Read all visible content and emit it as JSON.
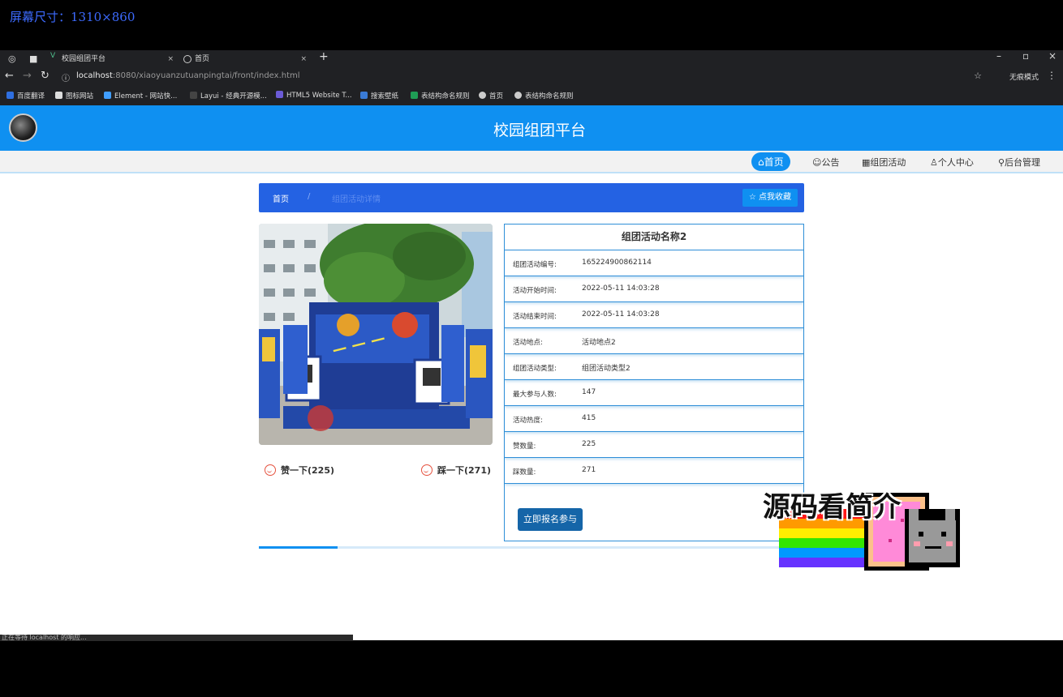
{
  "screen_caption": "屏幕尺寸：1310×860",
  "browser": {
    "tabs": [
      {
        "label": "校园组团平台",
        "close": "×"
      },
      {
        "label": "首页",
        "close": "×"
      }
    ],
    "new_tab": "+",
    "url_host": "localhost",
    "url_rest": ":8080/xiaoyuanzutuanpingtai/front/index.html",
    "incognito_label": "无痕模式",
    "bookmarks": [
      "百度翻译",
      "图标网站",
      "Element - 网站快...",
      "Layui - 经典开源模...",
      "HTML5 Website T...",
      "搜索壁纸",
      "表结构命名规则",
      "首页",
      "表结构命名规则"
    ],
    "status_tip": "正在等待 localhost 的响应..."
  },
  "header": {
    "title": "校园组团平台"
  },
  "nav": {
    "home": "⌂首页",
    "notice": "☺公告",
    "activity": "▦组团活动",
    "profile": "♙个人中心",
    "admin": "⚲后台管理"
  },
  "breadcrumb": {
    "home": "首页",
    "separator": "/",
    "current": "组团活动详情",
    "favorite": "☆ 点我收藏"
  },
  "detail": {
    "title": "组团活动名称2",
    "rows": [
      {
        "label": "组团活动编号:",
        "value": "165224900862114"
      },
      {
        "label": "活动开始时间:",
        "value": "2022-05-11 14:03:28"
      },
      {
        "label": "活动结束时间:",
        "value": "2022-05-11 14:03:28"
      },
      {
        "label": "活动地点:",
        "value": "活动地点2"
      },
      {
        "label": "组团活动类型:",
        "value": "组团活动类型2"
      },
      {
        "label": "最大参与人数:",
        "value": "147"
      },
      {
        "label": "活动热度:",
        "value": "415"
      },
      {
        "label": "赞数量:",
        "value": "225"
      },
      {
        "label": "踩数量:",
        "value": "271"
      }
    ],
    "join_button": "立即报名参与"
  },
  "votes": {
    "like": "赞一下(225)",
    "dislike": "踩一下(271)"
  },
  "overlay_caption": "源码看简介",
  "colors": {
    "header": "#0f90f1",
    "breadcrumb": "#2462e3",
    "border": "#2f8fd8",
    "join_button": "#1565a8"
  }
}
